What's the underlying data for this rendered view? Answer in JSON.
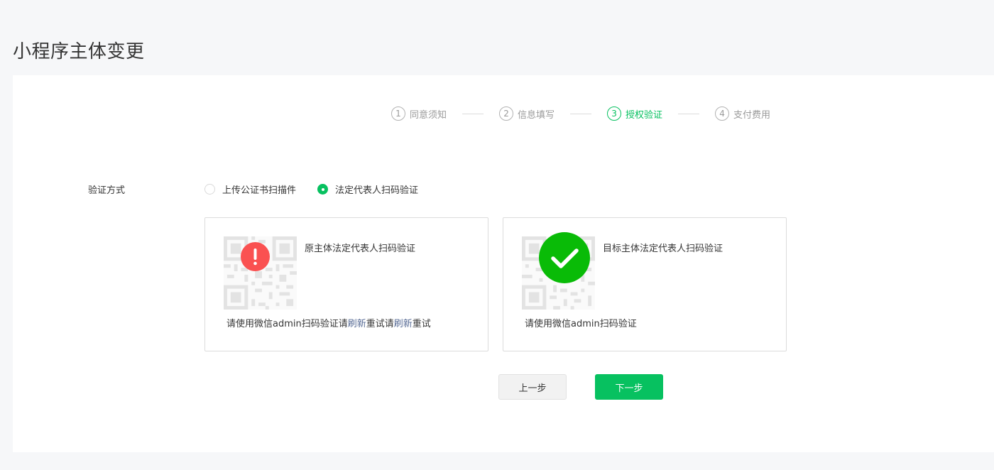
{
  "page": {
    "title": "小程序主体变更"
  },
  "steps": [
    {
      "num": "1",
      "label": "同意须知",
      "active": false
    },
    {
      "num": "2",
      "label": "信息填写",
      "active": false
    },
    {
      "num": "3",
      "label": "授权验证",
      "active": true
    },
    {
      "num": "4",
      "label": "支付费用",
      "active": false
    }
  ],
  "method": {
    "label": "验证方式",
    "options": [
      {
        "label": "上传公证书扫描件",
        "checked": false
      },
      {
        "label": "法定代表人扫码验证",
        "checked": true
      }
    ]
  },
  "cards": {
    "original": {
      "title": "原主体法定代表人扫码验证",
      "desc_prefix": "请使用微信admin扫码验证请",
      "link1": "刷新",
      "mid": "重试请",
      "link2": "刷新",
      "suffix": "重试",
      "status_icon": "exclamation-icon",
      "status_color": "#fa5151"
    },
    "target": {
      "title": "目标主体法定代表人扫码验证",
      "desc": "请使用微信admin扫码验证",
      "status_icon": "checkmark-icon",
      "status_color": "#09bb07"
    }
  },
  "buttons": {
    "prev": "上一步",
    "next": "下一步"
  },
  "colors": {
    "accent": "#07c160",
    "link": "#576b95",
    "error": "#fa5151",
    "success": "#09bb07"
  }
}
